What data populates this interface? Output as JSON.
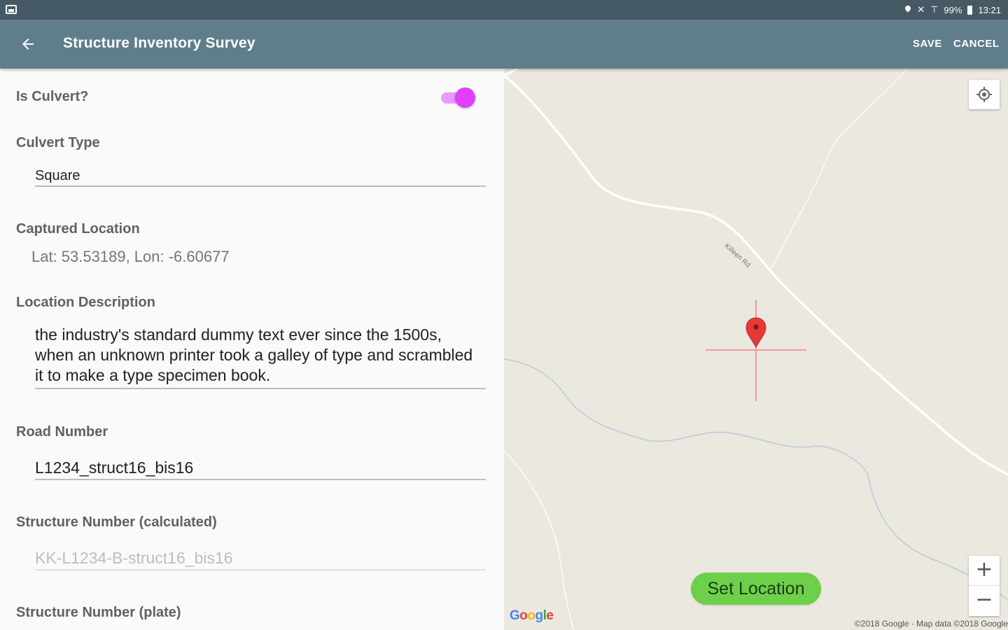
{
  "status_bar": {
    "battery": "99%",
    "time": "13:21"
  },
  "app_bar": {
    "title": "Structure Inventory Survey",
    "save_label": "SAVE",
    "cancel_label": "CANCEL"
  },
  "form": {
    "is_culvert": {
      "label": "Is Culvert?",
      "checked": true
    },
    "culvert_type": {
      "label": "Culvert Type",
      "value": "Square"
    },
    "captured_location": {
      "label": "Captured Location",
      "value": "Lat: 53.53189, Lon: -6.60677"
    },
    "location_description": {
      "label": "Location Description",
      "value": "the industry's standard dummy text ever since the 1500s, when an unknown printer took a galley of type and scrambled it to make a type specimen book."
    },
    "road_number": {
      "label": "Road Number",
      "value": "L1234_struct16_bis16"
    },
    "structure_number_calculated": {
      "label": "Structure Number (calculated)",
      "value": "KK-L1234-B-struct16_bis16"
    },
    "structure_number_plate": {
      "label": "Structure Number (plate)"
    }
  },
  "map": {
    "road_name": "Killeen Rd",
    "set_location_label": "Set Location",
    "zoom_in": "+",
    "zoom_out": "−",
    "google_logo": "Google",
    "credit": "©2018 Google · Map data ©2018 Google",
    "colors": {
      "land": "#ebe8e0",
      "road": "#ffffff",
      "water": "#a9c4d6",
      "pin": "#e53935",
      "button": "#6ed04a"
    }
  }
}
